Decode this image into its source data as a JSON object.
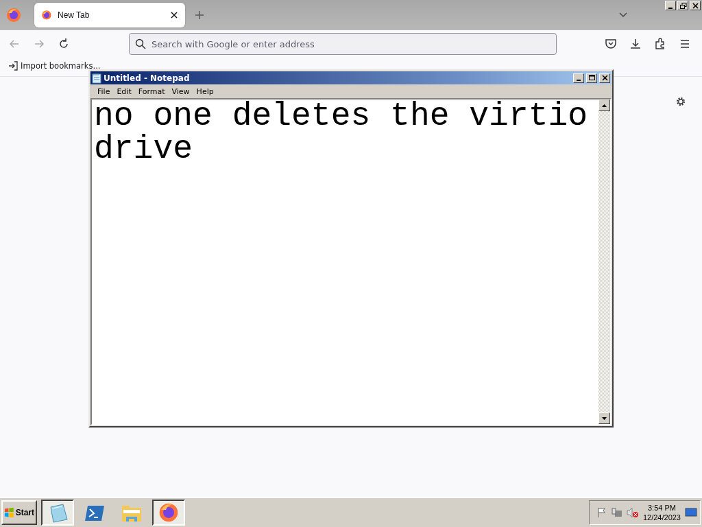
{
  "browser": {
    "tabs": [
      {
        "label": "New Tab",
        "selected": true
      }
    ],
    "address_bar": {
      "placeholder": "Search with Google or enter address"
    },
    "bookmarks": [
      {
        "label": "Import bookmarks...",
        "kind": "import"
      }
    ]
  },
  "notepad": {
    "title": "Untitled - Notepad",
    "menu": [
      "File",
      "Edit",
      "Format",
      "View",
      "Help"
    ],
    "text": "no one deletes the virtio drive"
  },
  "taskbar": {
    "start": "Start",
    "apps": [
      {
        "kind": "notepad",
        "selected": true
      },
      {
        "kind": "powershell",
        "selected": false
      },
      {
        "kind": "explorer",
        "selected": false
      },
      {
        "kind": "firefox",
        "selected": true
      }
    ],
    "time": "3:54 PM",
    "date": "12/24/2023"
  }
}
